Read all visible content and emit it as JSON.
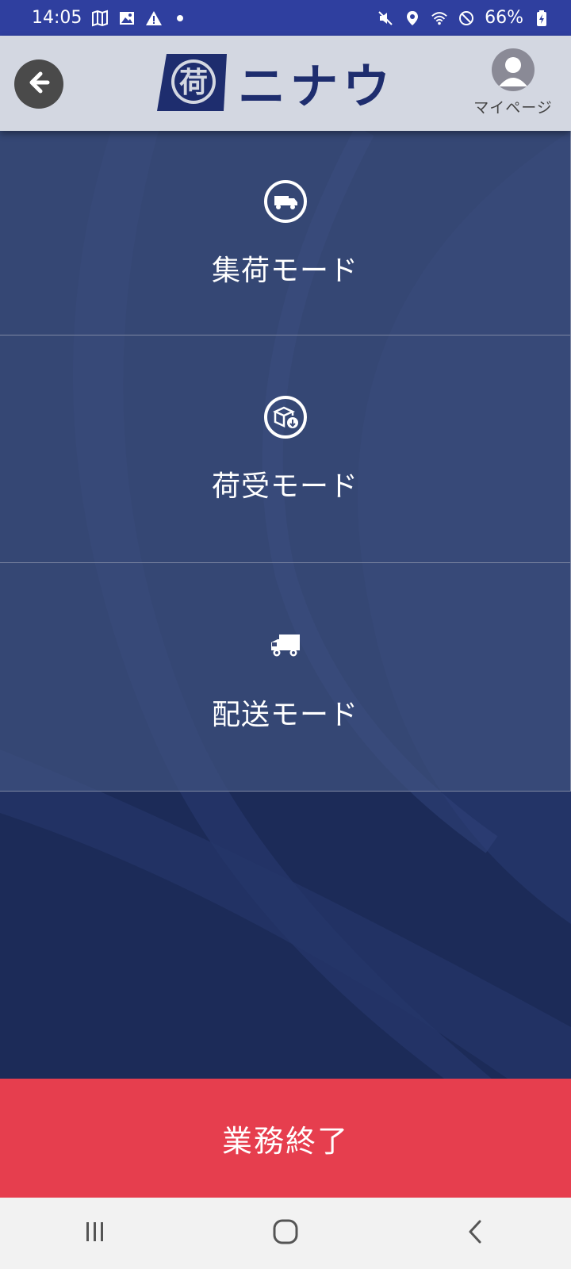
{
  "status_bar": {
    "time": "14:05",
    "battery": "66%"
  },
  "header": {
    "logo_mark": "荷",
    "logo_text": "ニナウ",
    "mypage_label": "マイページ"
  },
  "modes": [
    {
      "label": "集荷モード",
      "icon": "truck-circle-icon"
    },
    {
      "label": "荷受モード",
      "icon": "package-receive-icon"
    },
    {
      "label": "配送モード",
      "icon": "truck-icon"
    }
  ],
  "end_button": {
    "label": "業務終了"
  },
  "colors": {
    "status_bar": "#2f3f9f",
    "header_bg": "#d3d7e1",
    "brand_navy": "#1c2b58",
    "end_button": "#e63e4e"
  }
}
